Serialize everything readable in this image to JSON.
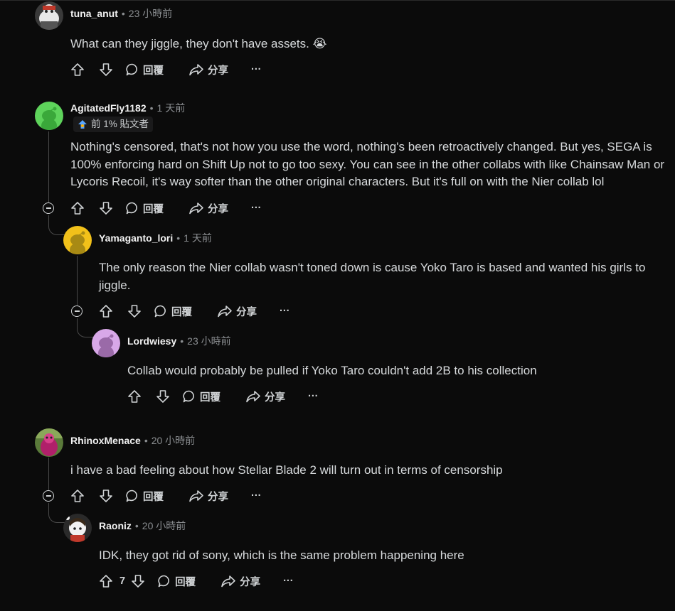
{
  "comments": [
    {
      "id": "c1",
      "author": "tuna_anut",
      "time": "23 小時前",
      "body": "What can they jiggle, they don't have assets. 😭",
      "actions": {
        "reply": "回覆",
        "share": "分享",
        "more": "···"
      }
    },
    {
      "id": "c2",
      "author": "AgitatedFly1182",
      "time": "1 天前",
      "flair": "前 1% 貼文者",
      "body": "Nothing's censored, that's not how you use the word, nothing's been retroactively changed. But yes, SEGA is 100% enforcing hard on Shift Up not to go too sexy. You can see in the other collabs with like Chainsaw Man or Lycoris Recoil, it's way softer than the other original characters. But it's full on with the Nier collab lol",
      "actions": {
        "reply": "回覆",
        "share": "分享",
        "more": "···"
      }
    },
    {
      "id": "c3",
      "author": "Yamaganto_lori",
      "time": "1 天前",
      "body": "The only reason the Nier collab wasn't toned down is cause Yoko Taro is based and wanted his girls to jiggle.",
      "actions": {
        "reply": "回覆",
        "share": "分享",
        "more": "···"
      }
    },
    {
      "id": "c4",
      "author": "Lordwiesy",
      "time": "23 小時前",
      "body": "Collab would probably be pulled if Yoko Taro couldn't add 2B to his collection",
      "actions": {
        "reply": "回覆",
        "share": "分享",
        "more": "···"
      }
    },
    {
      "id": "c5",
      "author": "RhinoxMenace",
      "time": "20 小時前",
      "body": "i have a bad feeling about how Stellar Blade 2 will turn out in terms of censorship",
      "actions": {
        "reply": "回覆",
        "share": "分享",
        "more": "···"
      }
    },
    {
      "id": "c6",
      "author": "Raoniz",
      "time": "20 小時前",
      "score": "7",
      "body": "IDK, they got rid of sony, which is the same problem happening here",
      "actions": {
        "reply": "回覆",
        "share": "分享",
        "more": "···"
      }
    }
  ],
  "colors": {
    "background": "#0b0b0b",
    "text": "#d7dadc",
    "meta": "#8a8d90",
    "thread_line": "#4a4a4a"
  }
}
